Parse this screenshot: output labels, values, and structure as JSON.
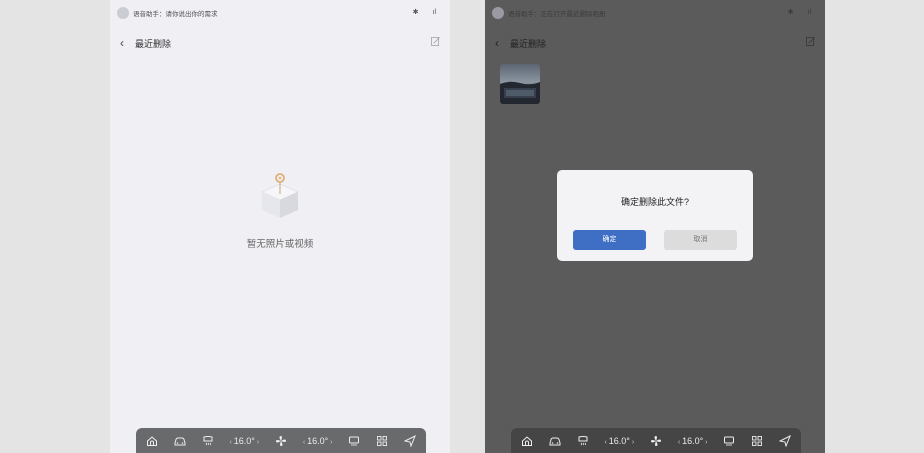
{
  "left": {
    "status": {
      "text": "语音助手：请你说出你的需求"
    },
    "nav": {
      "title": "最近删除"
    },
    "empty": {
      "message": "暂无照片或视频"
    },
    "dock": {
      "temp_left": "16.0°",
      "temp_right": "16.0°"
    }
  },
  "right": {
    "status": {
      "text": "语音助手：正在打开最近删除相册"
    },
    "nav": {
      "title": "最近删除"
    },
    "thumbnail": {
      "caption": "IMAGE"
    },
    "dialog": {
      "message": "确定删除此文件?",
      "confirm_label": "确定",
      "cancel_label": "取消"
    },
    "dock": {
      "temp_left": "16.0°",
      "temp_right": "16.0°"
    }
  },
  "icons": [
    "avatar-icon",
    "bluetooth-icon",
    "signal-icon",
    "back-icon",
    "edit-icon",
    "empty-box-icon",
    "home-icon",
    "car-icon",
    "seat-heat-icon",
    "fan-icon",
    "rear-defrost-icon",
    "apps-grid-icon",
    "navigation-icon"
  ],
  "colors": {
    "left_bg": "#efeff4",
    "overlay_bg": "#5b5b5b",
    "confirm_blue": "#3f6fc4",
    "dialog_bg": "#f3f3f5"
  }
}
